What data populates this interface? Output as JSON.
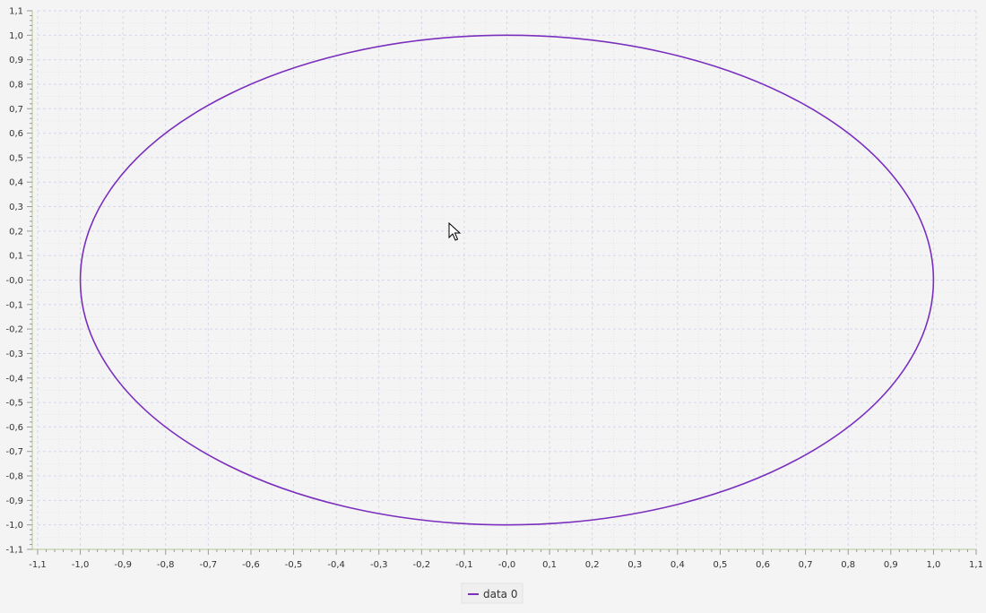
{
  "chart_data": {
    "type": "line",
    "title": "",
    "xlabel": "",
    "ylabel": "",
    "xlim": [
      -1.1,
      1.1
    ],
    "ylim": [
      -1.1,
      1.1
    ],
    "grid": true,
    "legend_position": "bottom-center",
    "x_ticks": [
      "-1,1",
      "-1,0",
      "-0,9",
      "-0,8",
      "-0,7",
      "-0,6",
      "-0,5",
      "-0,4",
      "-0,3",
      "-0,2",
      "-0,1",
      "-0,0",
      "0,1",
      "0,2",
      "0,3",
      "0,4",
      "0,5",
      "0,6",
      "0,7",
      "0,8",
      "0,9",
      "1,0",
      "1,1"
    ],
    "y_ticks": [
      "1,1",
      "1,0",
      "0,9",
      "0,8",
      "0,7",
      "0,6",
      "0,5",
      "0,4",
      "0,3",
      "0,2",
      "0,1",
      "-0,0",
      "-0,1",
      "-0,2",
      "-0,3",
      "-0,4",
      "-0,5",
      "-0,6",
      "-0,7",
      "-0,8",
      "-0,9",
      "-1,0",
      "-1,1"
    ],
    "series": [
      {
        "name": "data 0",
        "color": "#7b2fbe",
        "shape": "ellipse",
        "center": [
          0,
          0
        ],
        "radius_x": 1.0,
        "radius_y": 1.0
      }
    ]
  },
  "colors": {
    "background": "#f4f4f4",
    "grid": "#d8d8e8",
    "axis": "#b5c98f",
    "series": "#7b2fbe"
  },
  "icons": {
    "cursor": "mouse-pointer-icon"
  }
}
